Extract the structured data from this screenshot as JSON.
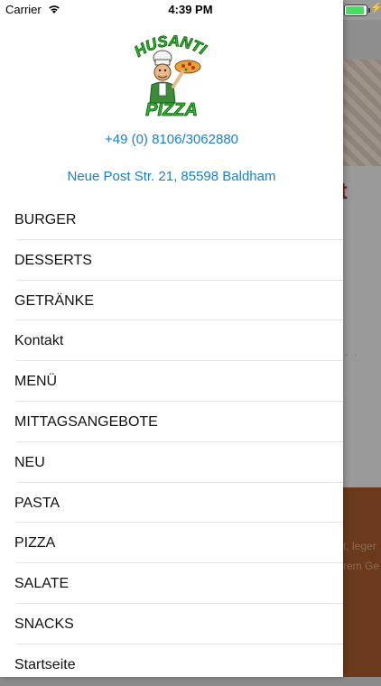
{
  "status_bar": {
    "carrier": "Carrier",
    "time": "4:39 PM",
    "battery_color": "#4cd964"
  },
  "drawer": {
    "logo": {
      "text_top": "HUSANTI",
      "text_bottom": "PIZZA",
      "color": "#2db82d"
    },
    "phone": "+49 (0) 8106/3062880",
    "address": "Neue Post Str. 21, 85598 Baldham",
    "link_color": "#1a7fd0",
    "menu_items": [
      {
        "label": "BURGER"
      },
      {
        "label": "DESSERTS"
      },
      {
        "label": "GETRÄNKE"
      },
      {
        "label": "Kontakt"
      },
      {
        "label": "MENÜ"
      },
      {
        "label": "MITTAGSANGEBOTE"
      },
      {
        "label": "NEU"
      },
      {
        "label": "PASTA"
      },
      {
        "label": "PIZZA"
      },
      {
        "label": "SALATE"
      },
      {
        "label": "SNACKS"
      },
      {
        "label": "Startseite"
      }
    ]
  },
  "background": {
    "heading_fragment": "t",
    "dash_fragment": "- -",
    "text_fragment_1": "t, leger",
    "text_fragment_2": "rem Ge"
  }
}
